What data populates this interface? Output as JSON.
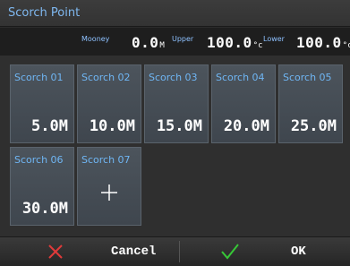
{
  "title": "Scorch Point",
  "status": {
    "mooney_label": "Mooney",
    "mooney_value": "0.0",
    "mooney_unit": "M",
    "upper_label": "Upper",
    "upper_value": "100.0",
    "upper_unit": "°c",
    "lower_label": "Lower",
    "lower_value": "100.0",
    "lower_unit": "°c"
  },
  "tiles": [
    {
      "name": "Scorch 01",
      "value": "5.0M"
    },
    {
      "name": "Scorch 02",
      "value": "10.0M"
    },
    {
      "name": "Scorch 03",
      "value": "15.0M"
    },
    {
      "name": "Scorch 04",
      "value": "20.0M"
    },
    {
      "name": "Scorch 05",
      "value": "25.0M"
    },
    {
      "name": "Scorch 06",
      "value": "30.0M"
    },
    {
      "name": "Scorch 07",
      "value": ""
    }
  ],
  "buttons": {
    "cancel_label": "Cancel",
    "ok_label": "OK"
  },
  "colors": {
    "title_text": "#7fb8f0",
    "tile_label": "#6fb6f4",
    "cancel_icon": "#e03a3a",
    "ok_icon": "#37c737"
  },
  "icons": {
    "add": "plus-icon",
    "cancel": "x-icon",
    "ok": "check-icon"
  }
}
